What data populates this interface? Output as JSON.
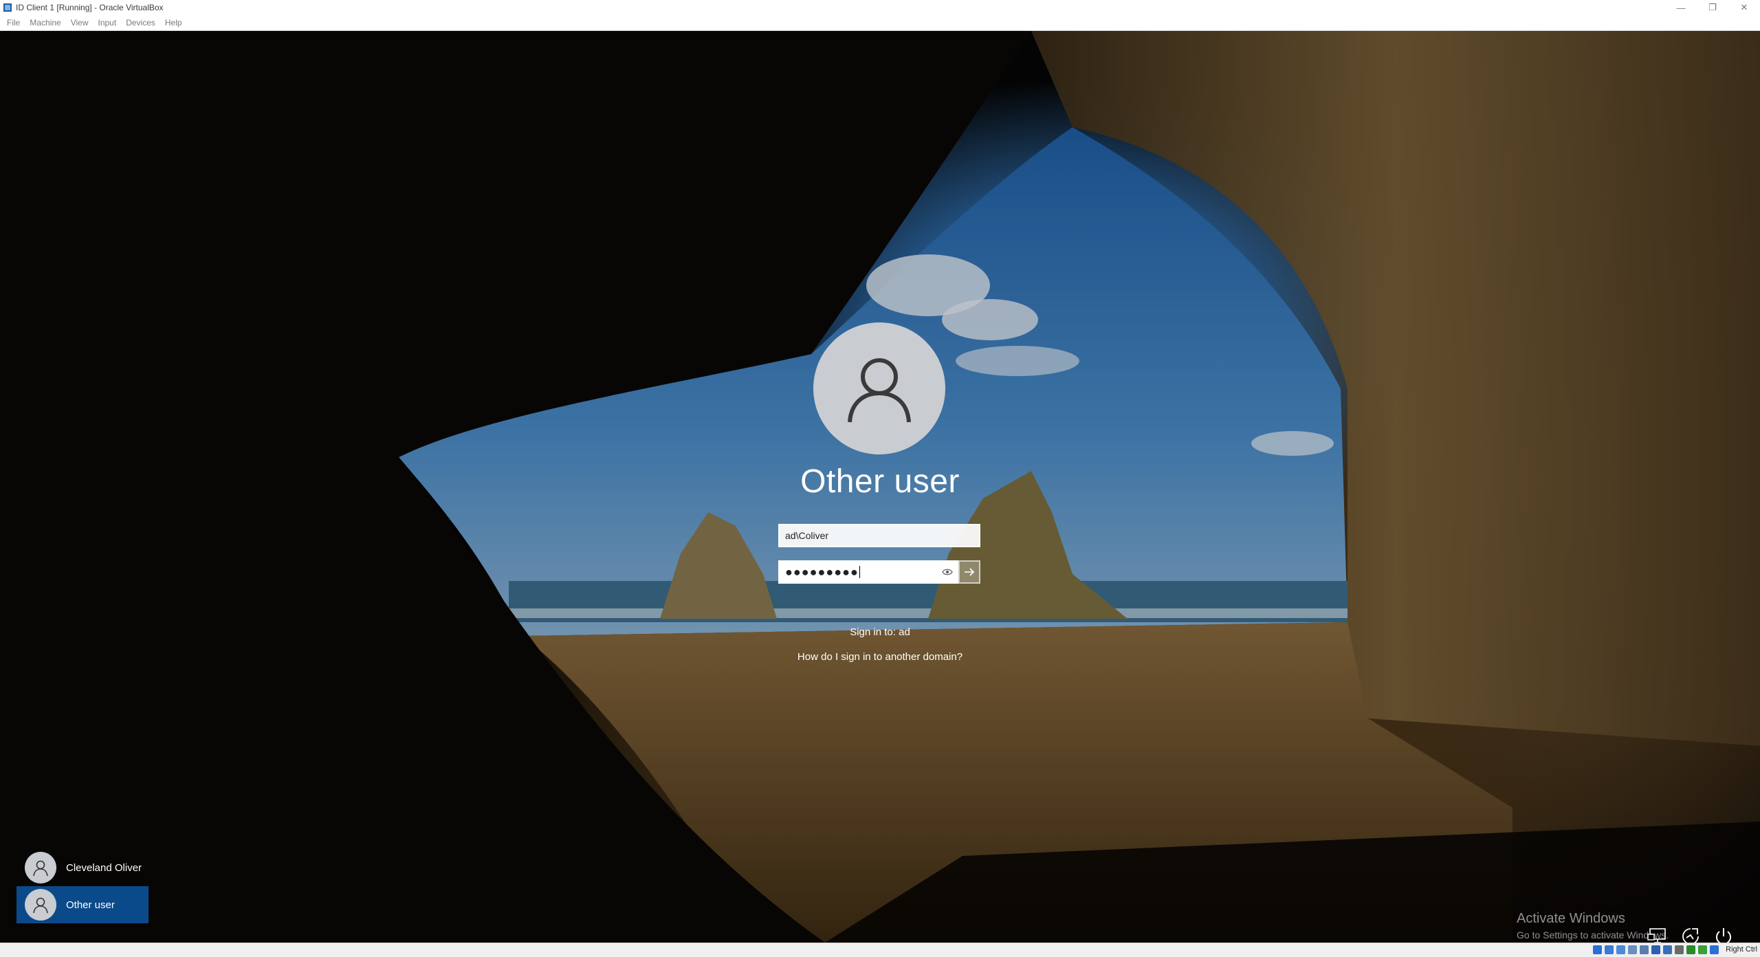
{
  "window": {
    "title": "ID Client 1 [Running] - Oracle VirtualBox",
    "minimize_glyph": "—",
    "restore_glyph": "❐",
    "close_glyph": "✕"
  },
  "menu": [
    "File",
    "Machine",
    "View",
    "Input",
    "Devices",
    "Help"
  ],
  "login": {
    "display_name": "Other user",
    "username_value": "ad\\Coliver",
    "password_mask": "●●●●●●●●●",
    "sign_in_to": "Sign in to: ad",
    "other_domain_link": "How do I sign in to another domain?"
  },
  "users": [
    {
      "name": "Cleveland Oliver",
      "selected": false
    },
    {
      "name": "Other user",
      "selected": true
    }
  ],
  "watermark": {
    "line1": "Activate Windows",
    "line2": "Go to Settings to activate Windows."
  },
  "statusbar": {
    "host_key": "Right Ctrl",
    "icon_colors": [
      "#2a6fd6",
      "#3a7bd5",
      "#4a8ad8",
      "#6a8fc0",
      "#5a7cb0",
      "#2f5fb0",
      "#3a6fb8",
      "#6a6a6a",
      "#2a8a2a",
      "#3aa03a",
      "#2a6fd6"
    ]
  },
  "colors": {
    "selected_tile": "#0a4a8a",
    "avatar_bg": "#c9ccd0"
  }
}
